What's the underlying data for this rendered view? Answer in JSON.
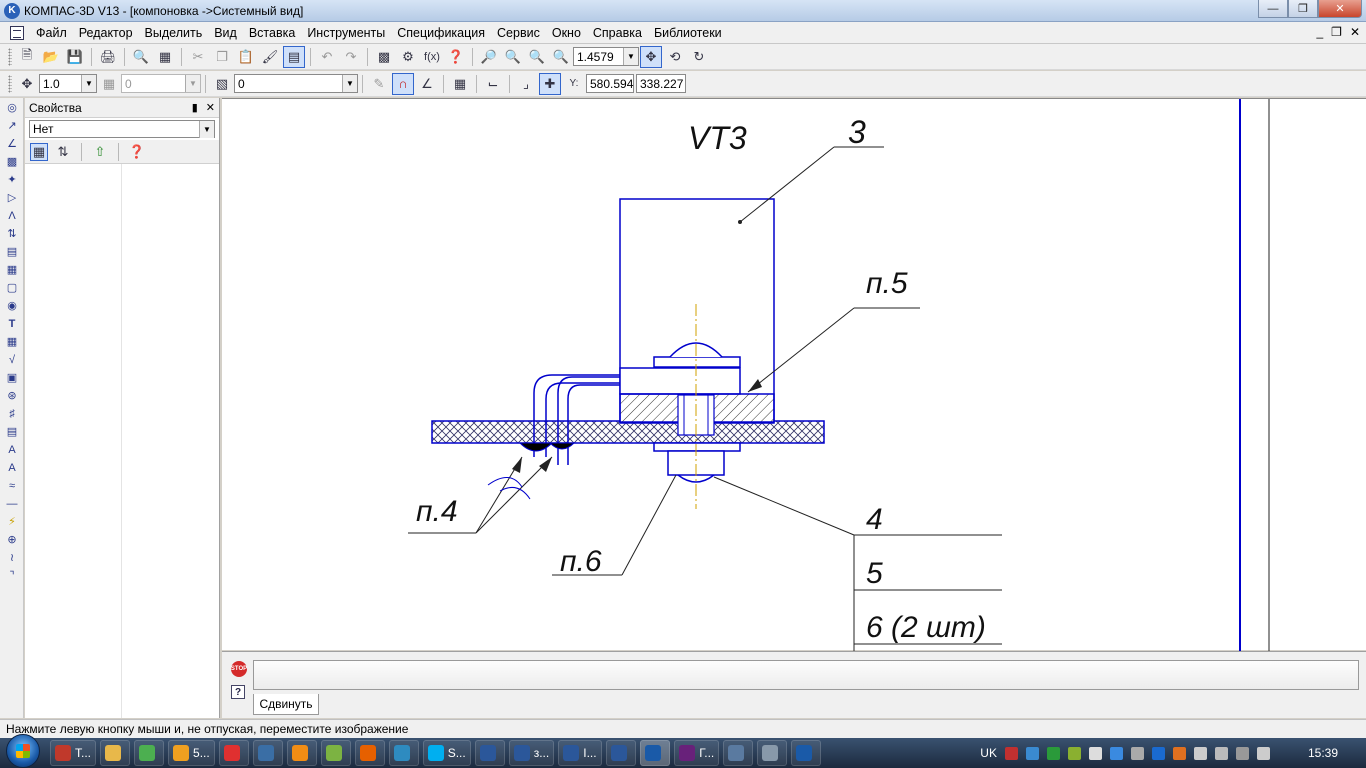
{
  "window": {
    "title": "КОМПАС-3D V13 - [компоновка ->Системный вид]",
    "app_icon_letter": "K"
  },
  "menu": {
    "items": [
      "Файл",
      "Редактор",
      "Выделить",
      "Вид",
      "Вставка",
      "Инструменты",
      "Спецификация",
      "Сервис",
      "Окно",
      "Справка",
      "Библиотеки"
    ]
  },
  "toolbar1": {
    "zoom_value": "1.4579"
  },
  "toolbar2": {
    "step_value": "1.0",
    "angle_value": "0",
    "layer_value": "0",
    "coord_x": "580.594",
    "coord_y": "338.227",
    "coord_label": "Y:"
  },
  "props_panel": {
    "title": "Свойства",
    "selected": "Нет",
    "pin_icon": "pin-icon",
    "close_icon": "close-icon"
  },
  "drawing": {
    "labels": {
      "component": "VT3",
      "leader_3": "3",
      "note_5": "п.5",
      "note_4": "п.4",
      "note_6": "п.6",
      "pos_4": "4",
      "pos_5": "5",
      "pos_6": "6 (2 шт)"
    },
    "line_color": "#0000cc",
    "hatch_color": "#333366"
  },
  "command_panel": {
    "tab_label": "Сдвинуть",
    "stop_text": "STOP"
  },
  "statusbar": {
    "text": "Нажмите левую кнопку мыши и, не отпуская, переместите изображение"
  },
  "taskbar": {
    "items": [
      {
        "icon": "document-icon",
        "label": "T...",
        "color": "#c0392b"
      },
      {
        "icon": "folder-icon",
        "label": "",
        "color": "#e8b84a"
      },
      {
        "icon": "chrome-icon",
        "label": "",
        "color": "#4caf50"
      },
      {
        "icon": "pencil-icon",
        "label": "5...",
        "color": "#f0a020"
      },
      {
        "icon": "yandex-icon",
        "label": "",
        "color": "#e03030"
      },
      {
        "icon": "opera-icon",
        "label": "",
        "color": "#3a6ea5"
      },
      {
        "icon": "odnoklassniki-icon",
        "label": "",
        "color": "#f28d14"
      },
      {
        "icon": "uTorrent-icon",
        "label": "",
        "color": "#7cb342"
      },
      {
        "icon": "firefox-icon",
        "label": "",
        "color": "#e66000"
      },
      {
        "icon": "diamond-icon",
        "label": "",
        "color": "#2e8bc0"
      },
      {
        "icon": "skype-icon",
        "label": "S...",
        "color": "#00aff0"
      },
      {
        "icon": "word-icon",
        "label": "",
        "color": "#2b579a"
      },
      {
        "icon": "word-icon",
        "label": "з...",
        "color": "#2b579a"
      },
      {
        "icon": "word-icon",
        "label": "I...",
        "color": "#2b579a"
      },
      {
        "icon": "word-icon",
        "label": "",
        "color": "#2b579a"
      },
      {
        "icon": "kompas-icon",
        "label": "",
        "color": "#1a5aa8"
      },
      {
        "icon": "visual-studio-icon",
        "label": "Г...",
        "color": "#68217a"
      },
      {
        "icon": "monitor-icon",
        "label": "",
        "color": "#5a7aa0"
      },
      {
        "icon": "car-icon",
        "label": "",
        "color": "#8899aa"
      },
      {
        "icon": "kompas-icon",
        "label": "",
        "color": "#1a5aa8"
      }
    ],
    "language": "UK",
    "clock": "15:39"
  }
}
